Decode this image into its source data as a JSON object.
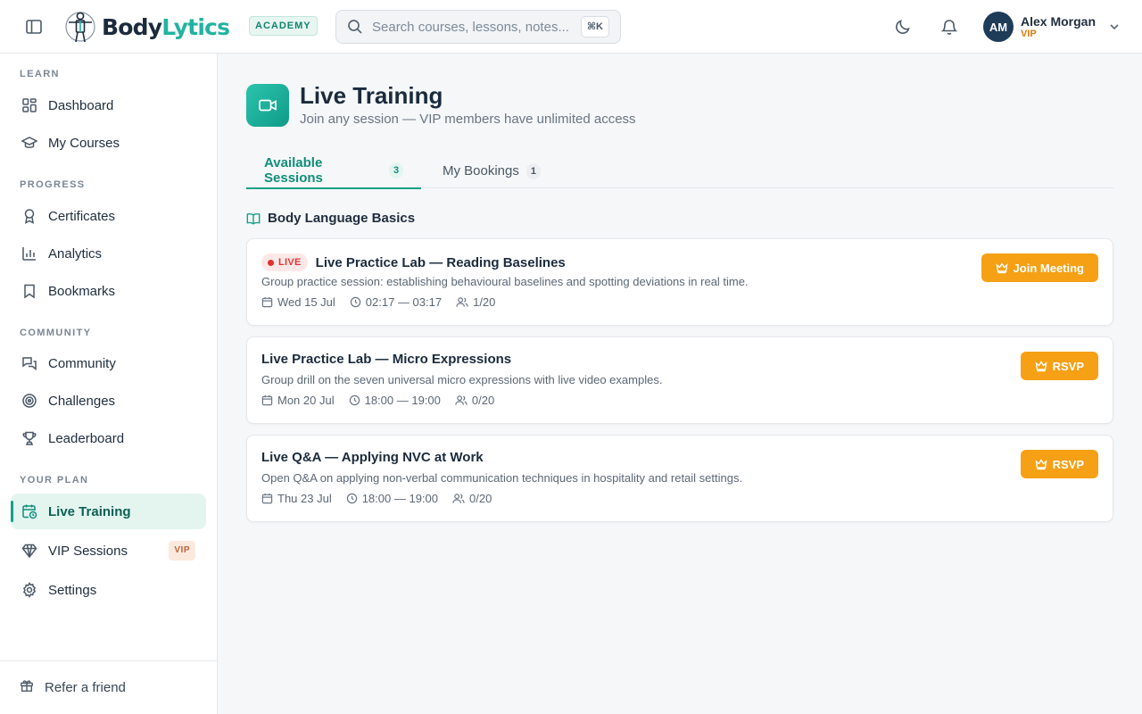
{
  "brand": {
    "name_part1": "Body",
    "name_part2": "Lytics",
    "badge": "ACADEMY"
  },
  "search": {
    "placeholder": "Search courses, lessons, notes...",
    "shortcut": "⌘K"
  },
  "user": {
    "initials": "AM",
    "name": "Alex Morgan",
    "plan": "VIP"
  },
  "sidebar": {
    "sections": [
      {
        "label": "LEARN",
        "items": [
          {
            "label": "Dashboard",
            "icon": "grid-icon"
          },
          {
            "label": "My Courses",
            "icon": "graduation-cap-icon"
          }
        ]
      },
      {
        "label": "PROGRESS",
        "items": [
          {
            "label": "Certificates",
            "icon": "award-icon"
          },
          {
            "label": "Analytics",
            "icon": "bar-chart-icon"
          },
          {
            "label": "Bookmarks",
            "icon": "bookmark-icon"
          }
        ]
      },
      {
        "label": "COMMUNITY",
        "items": [
          {
            "label": "Community",
            "icon": "chat-icon"
          },
          {
            "label": "Challenges",
            "icon": "target-icon"
          },
          {
            "label": "Leaderboard",
            "icon": "trophy-icon"
          }
        ]
      },
      {
        "label": "YOUR PLAN",
        "items": [
          {
            "label": "Live Training",
            "icon": "calendar-clock-icon",
            "active": true
          },
          {
            "label": "VIP Sessions",
            "icon": "gem-icon",
            "tag": "VIP"
          },
          {
            "label": "Settings",
            "icon": "gear-icon"
          }
        ]
      }
    ],
    "footer": {
      "label": "Refer a friend",
      "icon": "gift-icon"
    }
  },
  "page": {
    "title": "Live Training",
    "subtitle": "Join any session — VIP members have unlimited access"
  },
  "tabs": [
    {
      "label": "Available Sessions",
      "count": "3",
      "active": true
    },
    {
      "label": "My Bookings",
      "count": "1",
      "active": false
    }
  ],
  "group": {
    "title": "Body Language Basics"
  },
  "sessions": [
    {
      "live": true,
      "live_label": "LIVE",
      "title": "Live Practice Lab — Reading Baselines",
      "description": "Group practice session: establishing behavioural baselines and spotting deviations in real time.",
      "date": "Wed 15 Jul",
      "time": "02:17 — 03:17",
      "attendees": "1/20",
      "action": "Join Meeting"
    },
    {
      "live": false,
      "title": "Live Practice Lab — Micro Expressions",
      "description": "Group drill on the seven universal micro expressions with live video examples.",
      "date": "Mon 20 Jul",
      "time": "18:00 — 19:00",
      "attendees": "0/20",
      "action": "RSVP"
    },
    {
      "live": false,
      "title": "Live Q&A — Applying NVC at Work",
      "description": "Open Q&A on applying non-verbal communication techniques in hospitality and retail settings.",
      "date": "Thu 23 Jul",
      "time": "18:00 — 19:00",
      "attendees": "0/20",
      "action": "RSVP"
    }
  ],
  "colors": {
    "accent": "#14a08a",
    "brand_dark": "#1b2b3c",
    "cta": "#f5a015",
    "live": "#e03131",
    "vip": "#d97a0b"
  }
}
